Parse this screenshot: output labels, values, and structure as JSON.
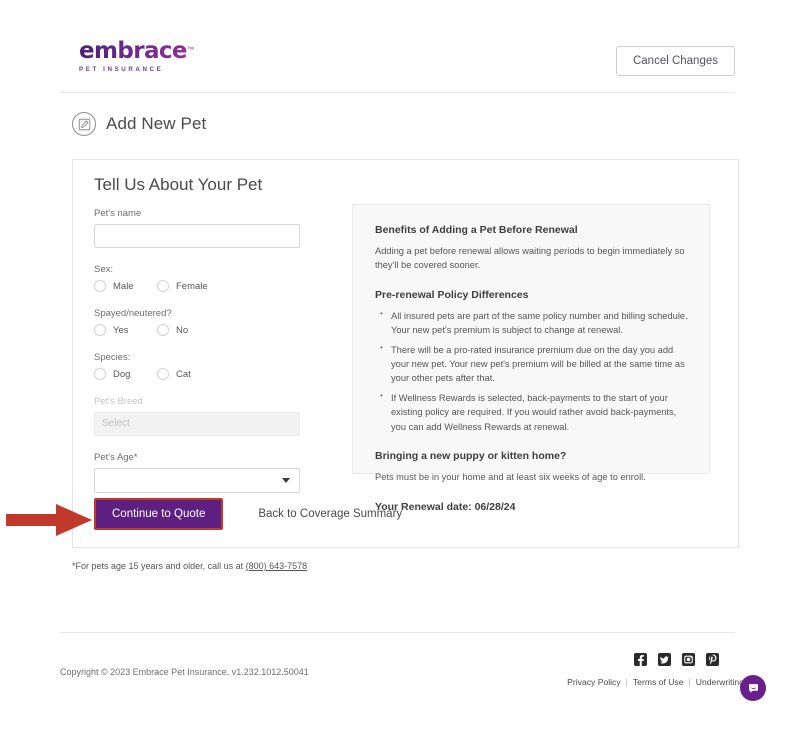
{
  "header": {
    "logo_word": "embrace",
    "logo_tm": "™",
    "logo_sub": "PET INSURANCE",
    "cancel_label": "Cancel Changes",
    "brand_color": "#5b2a86"
  },
  "page": {
    "title": "Add New Pet",
    "title_icon": "edit-square-icon"
  },
  "card": {
    "title": "Tell Us About Your Pet",
    "fields": {
      "name_label": "Pet's name",
      "name_value": "",
      "sex_label": "Sex:",
      "sex_options": [
        "Male",
        "Female"
      ],
      "spayed_label": "Spayed/neutered?",
      "spayed_options": [
        "Yes",
        "No"
      ],
      "species_label": "Species:",
      "species_options": [
        "Dog",
        "Cat"
      ],
      "breed_label": "Pet's Breed",
      "breed_placeholder": "Select",
      "age_label": "Pet's Age*",
      "age_value": ""
    },
    "actions": {
      "primary_label": "Continue to Quote",
      "secondary_label": "Back to Coverage Summary",
      "primary_bg": "#5d2080",
      "highlight_color": "#c0392b"
    }
  },
  "info_panel": {
    "heading_1": "Benefits of Adding a Pet Before Renewal",
    "para_1": "Adding a pet before renewal allows waiting periods to begin immediately so they'll be covered sooner.",
    "heading_2": "Pre-renewal Policy Differences",
    "bullets": [
      "All insured pets are part of the same policy number and billing schedule. Your new pet's premium is subject to change at renewal.",
      "There will be a pro-rated insurance premium due on the day you add your new pet. Your new pet's premium will be billed at the same time as your other pets after that.",
      "If Wellness Rewards is selected, back-payments to the start of your existing policy are required. If you would rather avoid back-payments, you can add Wellness Rewards at renewal."
    ],
    "heading_3": "Bringing a new puppy or kitten home?",
    "para_3": "Pets must be in your home and at least six weeks of age to enroll.",
    "renewal_line": "Your Renewal date: 06/28/24"
  },
  "footnote": {
    "text": "*For pets age 15 years and older, call us at ",
    "phone": "(800) 643-7578"
  },
  "footer": {
    "copyright": "Copyright © 2023   Embrace Pet Insurance. v1.232.1012.50041",
    "social": [
      "facebook-icon",
      "twitter-icon",
      "instagram-icon",
      "pinterest-icon"
    ],
    "links": [
      "Privacy Policy",
      "Terms of Use",
      "Underwriting"
    ],
    "separator": "|"
  },
  "chat_widget": {
    "icon": "chat-bubble-icon",
    "color": "#6a1f8f"
  },
  "annotation": {
    "arrow": "red-arrow-pointing-right",
    "color": "#c0392b"
  }
}
